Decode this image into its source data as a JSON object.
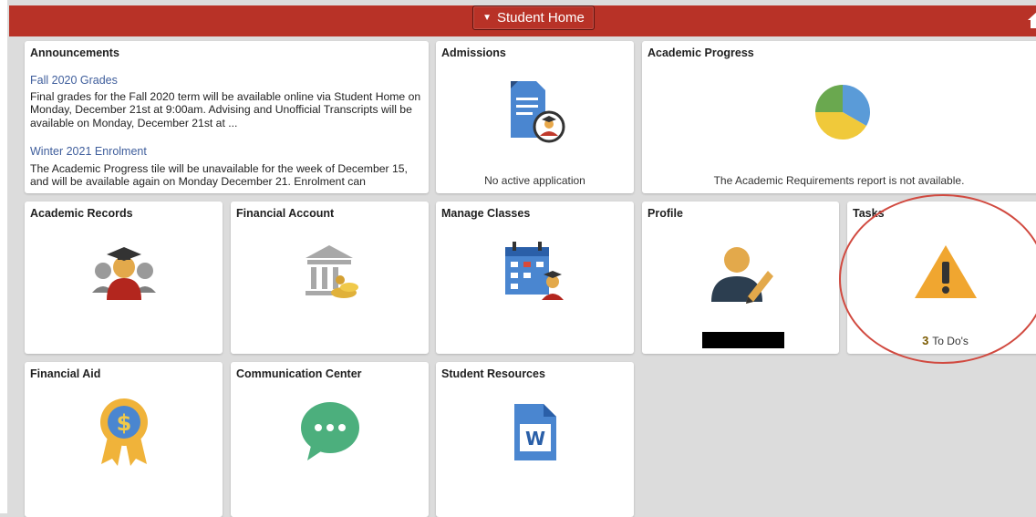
{
  "header": {
    "title": "Student Home",
    "caret_icon": "caret-down-icon",
    "home_icon": "home-icon",
    "bar_color": "#b83227"
  },
  "announcements": {
    "title": "Announcements",
    "items": [
      {
        "title": "Fall 2020 Grades",
        "body": "Final grades for the Fall 2020 term will be available online via Student Home on Monday, December 21st at 9:00am. Advising and Unofficial Transcripts will be available on Monday, December 21st at ..."
      },
      {
        "title": "Winter 2021 Enrolment",
        "body": "The Academic Progress tile will be unavailable for the week of December 15, and will be available again on Monday December 21. Enrolment can"
      }
    ]
  },
  "tiles": {
    "admissions": {
      "title": "Admissions",
      "footer": "No active application",
      "icon": "application-document-icon"
    },
    "academic_progress": {
      "title": "Academic Progress",
      "footer": "The Academic Requirements report is not available.",
      "icon": "pie-chart-icon"
    },
    "academic_records": {
      "title": "Academic Records",
      "icon": "graduates-icon"
    },
    "financial_account": {
      "title": "Financial Account",
      "icon": "bank-icon"
    },
    "manage_classes": {
      "title": "Manage Classes",
      "icon": "calendar-icon"
    },
    "profile": {
      "title": "Profile",
      "icon": "user-edit-icon"
    },
    "tasks": {
      "title": "Tasks",
      "count": "3",
      "count_label": "To Do's",
      "icon": "warning-icon"
    },
    "financial_aid": {
      "title": "Financial Aid",
      "icon": "award-ribbon-icon"
    },
    "communication_center": {
      "title": "Communication Center",
      "icon": "chat-bubble-icon"
    },
    "student_resources": {
      "title": "Student Resources",
      "icon": "word-document-icon"
    }
  }
}
